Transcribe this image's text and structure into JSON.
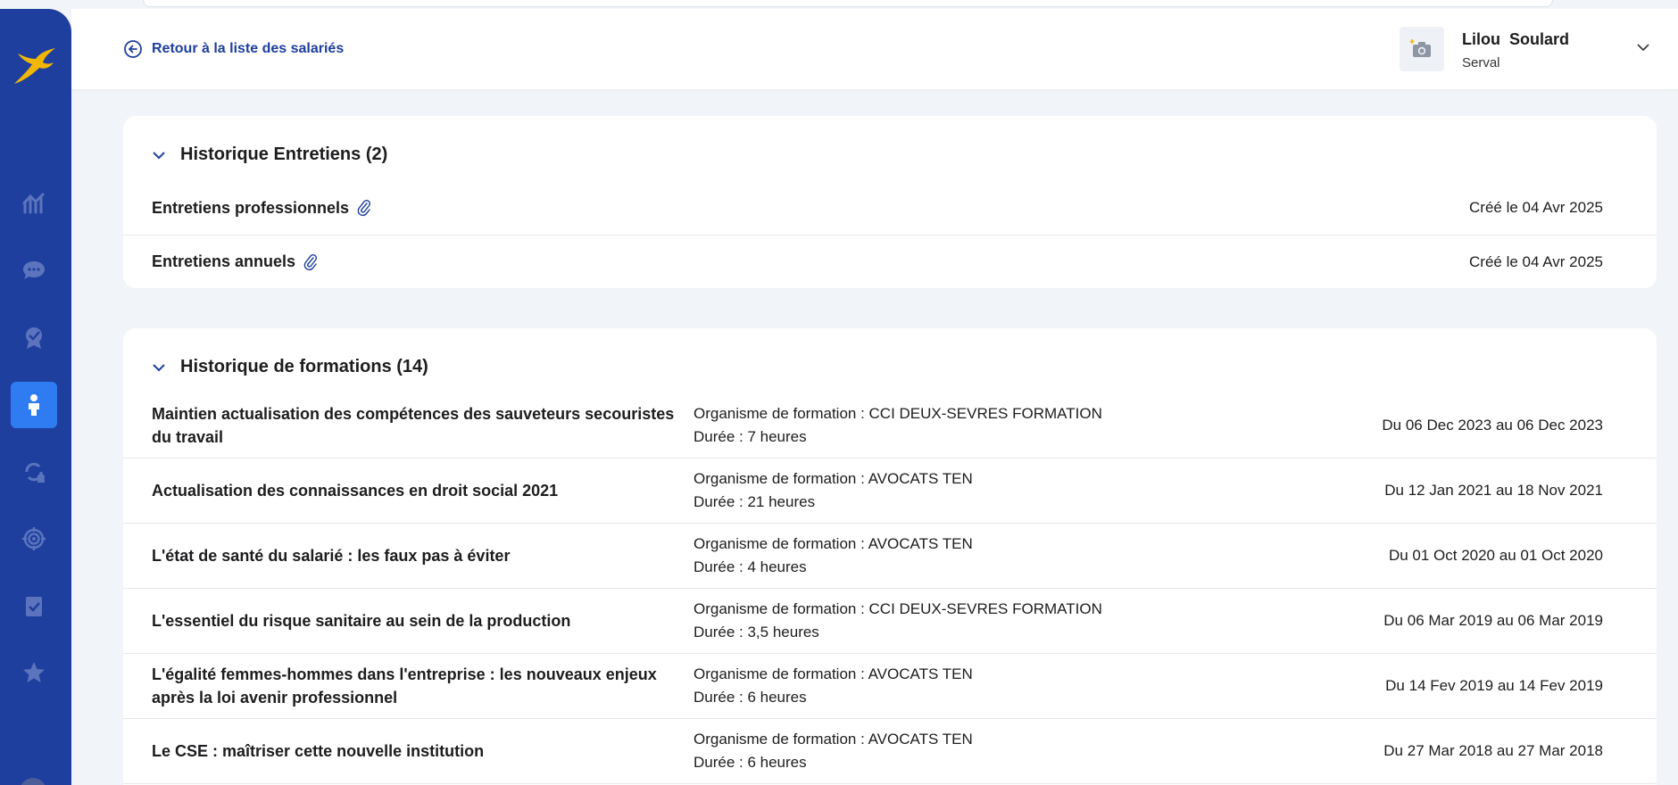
{
  "colors": {
    "sidebar": "#1e3f9e",
    "active": "#2f7bf1",
    "accent": "#1e3f9e",
    "logo": "#f2b705"
  },
  "sidebar": {
    "items": [
      {
        "icon": "dashboard-chart-icon",
        "active": false
      },
      {
        "icon": "chat-bubble-icon",
        "active": false
      },
      {
        "icon": "badge-check-icon",
        "active": false
      },
      {
        "icon": "person-icon",
        "active": true
      },
      {
        "icon": "refresh-people-icon",
        "active": false
      },
      {
        "icon": "target-icon",
        "active": false
      },
      {
        "icon": "clipboard-check-icon",
        "active": false
      },
      {
        "icon": "star-icon",
        "active": false
      }
    ]
  },
  "header": {
    "back_label": "Retour à la liste des salariés",
    "user_name": "Lilou  Soulard",
    "user_company": "Serval"
  },
  "entretiens": {
    "title": "Historique Entretiens (2)",
    "rows": [
      {
        "title": "Entretiens professionnels",
        "date": "Créé le 04 Avr 2025"
      },
      {
        "title": "Entretiens annuels",
        "date": "Créé le 04 Avr 2025"
      }
    ]
  },
  "formations": {
    "title": "Historique de formations (14)",
    "rows": [
      {
        "title": "Maintien actualisation des compétences des sauveteurs secouristes du travail",
        "organisme": "Organisme de formation : CCI DEUX-SEVRES FORMATION",
        "duree": "Durée : 7 heures",
        "dates": "Du 06 Dec 2023 au 06 Dec 2023"
      },
      {
        "title": "Actualisation des connaissances en droit social 2021",
        "organisme": "Organisme de formation : AVOCATS TEN",
        "duree": "Durée : 21 heures",
        "dates": "Du 12 Jan 2021 au 18 Nov 2021"
      },
      {
        "title": "L'état de santé du salarié : les faux pas à éviter",
        "organisme": "Organisme de formation : AVOCATS TEN",
        "duree": "Durée : 4 heures",
        "dates": "Du 01 Oct 2020 au 01 Oct 2020"
      },
      {
        "title": "L'essentiel du risque sanitaire au sein de la production",
        "organisme": "Organisme de formation : CCI DEUX-SEVRES FORMATION",
        "duree": "Durée : 3,5 heures",
        "dates": "Du 06 Mar 2019 au 06 Mar 2019"
      },
      {
        "title": "L'égalité femmes-hommes dans l'entreprise : les nouveaux enjeux après la loi avenir professionnel",
        "organisme": "Organisme de formation : AVOCATS TEN",
        "duree": "Durée : 6 heures",
        "dates": "Du 14 Fev 2019 au 14 Fev 2019"
      },
      {
        "title": "Le CSE : maîtriser cette nouvelle institution",
        "organisme": "Organisme de formation : AVOCATS TEN",
        "duree": "Durée : 6 heures",
        "dates": "Du 27 Mar 2018 au 27 Mar 2018"
      }
    ]
  }
}
